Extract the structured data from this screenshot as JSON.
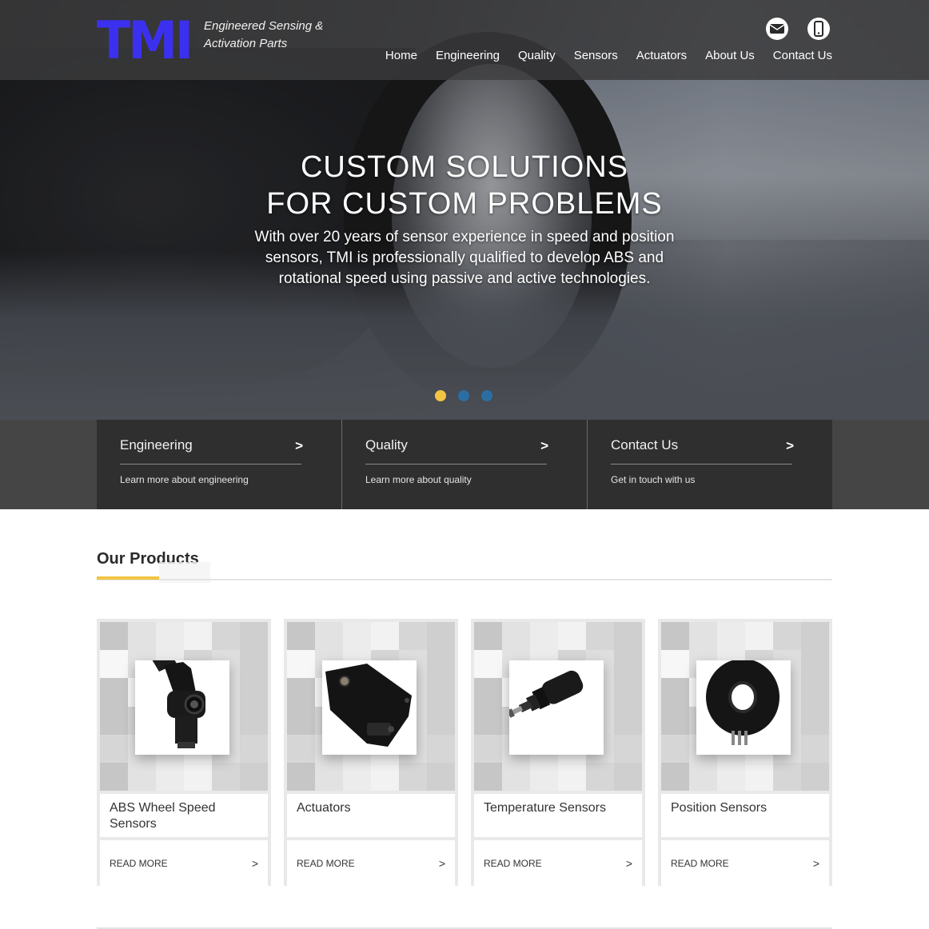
{
  "brand": {
    "logo_text": "TMI",
    "tagline_line1": "Engineered Sensing &",
    "tagline_line2": "Activation Parts",
    "logo_color": "#3b30f0"
  },
  "header": {
    "icons": [
      "email-icon",
      "phone-icon"
    ],
    "nav": [
      "Home",
      "Engineering",
      "Quality",
      "Sensors",
      "Actuators",
      "About Us",
      "Contact Us"
    ]
  },
  "hero": {
    "title_line1": "CUSTOM SOLUTIONS",
    "title_line2": "FOR CUSTOM PROBLEMS",
    "subtitle": "With over 20 years of sensor experience in speed and position sensors, TMI is professionally qualified to develop ABS and rotational speed using passive and active technologies.",
    "slides_total": 3,
    "active_slide": 1,
    "dot_active_color": "#f1c443",
    "dot_color": "#2b6ea4"
  },
  "features": [
    {
      "title": "Engineering",
      "arrow": ">",
      "description": "Learn more about engineering"
    },
    {
      "title": "Quality",
      "arrow": ">",
      "description": "Learn more about quality"
    },
    {
      "title": "Contact Us",
      "arrow": ">",
      "description": "Get in touch with us"
    }
  ],
  "products_section": {
    "title": "Our Products",
    "accent_color": "#f1c443",
    "items": [
      {
        "name": "ABS Wheel Speed Sensors",
        "cta": "READ MORE",
        "arrow": ">"
      },
      {
        "name": "Actuators",
        "cta": "READ MORE",
        "arrow": ">"
      },
      {
        "name": "Temperature Sensors",
        "cta": "READ MORE",
        "arrow": ">"
      },
      {
        "name": "Position Sensors",
        "cta": "READ MORE",
        "arrow": ">"
      }
    ]
  }
}
